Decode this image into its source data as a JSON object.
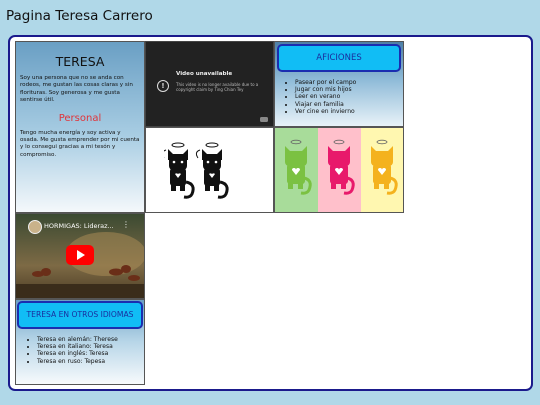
{
  "page": {
    "title": "Pagina Teresa Carrero"
  },
  "about": {
    "heading": "TERESA",
    "intro": "Soy una persona que no se anda con rodeos, me gustan las cosas claras y sin florituras. Soy generosa y me gusta sentirse útil.",
    "subheading": "Personal",
    "personal": "Tengo mucha energía y soy activa y osada. Me gusta emprender por mi cuenta y lo consegui gracias a mi tesón y compromiso."
  },
  "video_unavailable": {
    "title": "Video unavailable",
    "message": "This video is no longer available due to a copyright claim by Ting Chian Tey"
  },
  "hobbies": {
    "button": "AFICIONES",
    "items": [
      "Pasear por el campo",
      "Jugar con mis hijos",
      "Leer en verano",
      "Viajar en familia",
      "Ver cine en invierno"
    ]
  },
  "cats_panel": {
    "colors": [
      "#a8dc9a",
      "#ffc0cb",
      "#fff7b0"
    ],
    "cat_colors": [
      "#7bc142",
      "#e8196b",
      "#f4b21e"
    ]
  },
  "youtube": {
    "title": "HORMIGAS: Lideraz...",
    "menu": "⋮"
  },
  "languages": {
    "button": "TERESA EN OTROS IDIOMAS",
    "items": [
      "Teresa en alemán: Therese",
      "Teresa en italiano: Teresa",
      "Teresa en inglés: Teresa",
      "Teresa en ruso: Tepesa"
    ]
  }
}
